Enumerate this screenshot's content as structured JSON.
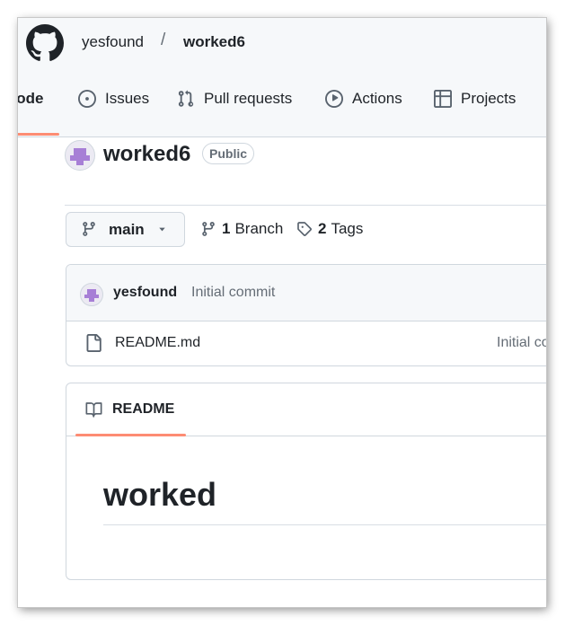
{
  "header": {
    "owner": "yesfound",
    "separator": "/",
    "repo": "worked6"
  },
  "tabs": [
    {
      "label": "Code",
      "visible_label": "Code",
      "icon": "code-icon",
      "selected": true
    },
    {
      "label": "Issues",
      "icon": "issue-opened-icon"
    },
    {
      "label": "Pull requests",
      "icon": "git-pull-request-icon"
    },
    {
      "label": "Actions",
      "icon": "play-icon"
    },
    {
      "label": "Projects",
      "icon": "table-icon"
    }
  ],
  "repo": {
    "name": "worked6",
    "visibility": "Public"
  },
  "branch_bar": {
    "current_branch": "main",
    "branch_count": "1",
    "branch_word": "Branch",
    "tag_count": "2",
    "tag_word": "Tags"
  },
  "latest_commit": {
    "author": "yesfound",
    "message": "Initial commit"
  },
  "files": [
    {
      "name": "README.md",
      "last_commit": "Initial commit",
      "icon": "file-icon"
    }
  ],
  "readme": {
    "tab_label": "README",
    "heading": "worked"
  },
  "colors": {
    "accent_underline": "#fd8c73",
    "header_bg": "#f6f8fa",
    "border": "#d0d7de",
    "muted_text": "#656d76",
    "avatar_purple": "#a77fd6"
  }
}
